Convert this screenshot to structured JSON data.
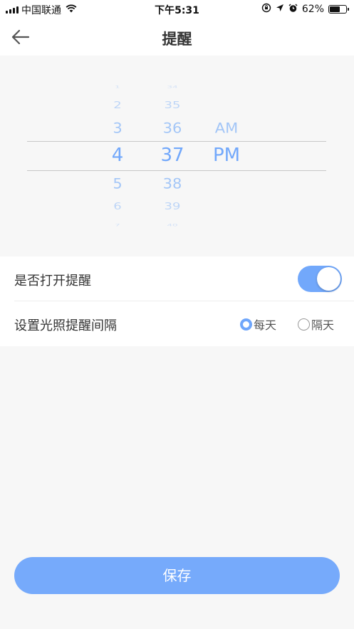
{
  "status_bar": {
    "carrier": "中国联通",
    "time": "下午5:31",
    "battery": "62%",
    "battery_level": 0.62,
    "icons": [
      "signal-icon",
      "wifi-icon",
      "rotation-lock-icon",
      "location-icon",
      "alarm-icon",
      "battery-icon"
    ]
  },
  "header": {
    "back_icon": "arrow-left-icon",
    "title": "提醒"
  },
  "picker": {
    "hours": [
      "1",
      "2",
      "3",
      "4",
      "5",
      "6",
      "7"
    ],
    "selected_hour": "4",
    "minutes": [
      "34",
      "35",
      "36",
      "37",
      "38",
      "39",
      "40"
    ],
    "selected_minute": "37",
    "ampm": [
      "AM",
      "PM"
    ],
    "selected_ampm": "PM"
  },
  "settings": {
    "reminder_toggle_label": "是否打开提醒",
    "reminder_on": true,
    "interval_label": "设置光照提醒间隔",
    "options": [
      {
        "label": "每天",
        "selected": true
      },
      {
        "label": "隔天",
        "selected": false
      }
    ]
  },
  "save_label": "保存",
  "colors": {
    "accent": "#72a8fb",
    "picker_text": "#8fbaf7",
    "background": "#f7f7f7"
  }
}
